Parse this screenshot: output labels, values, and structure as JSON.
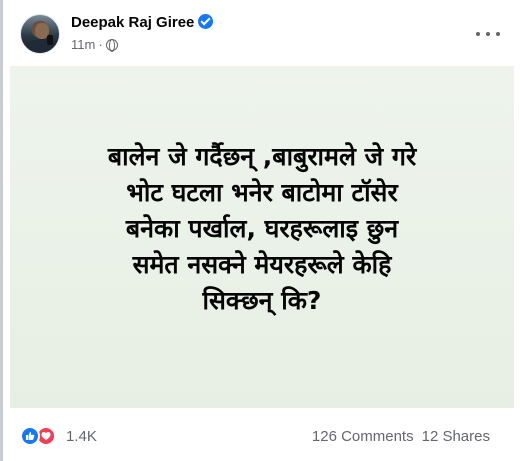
{
  "post": {
    "author": "Deepak Raj Giree",
    "verified": true,
    "time": "11m",
    "audience_icon": "globe-icon",
    "more_icon": "more-options-icon"
  },
  "card": {
    "background": "#e9f1e6",
    "lines": [
      "बालेन जे गर्दैछन् ,बाबुरामले जे गरे",
      "भोट घटला भनेर बाटोमा टॉसेर",
      "बनेका पर्खाल, घरहरूलाइ छुन",
      "समेत नसक्ने मेयरहरूले केहि",
      "सिक्छन् कि?"
    ]
  },
  "footer": {
    "reaction_icons": [
      "like-icon",
      "love-icon"
    ],
    "reaction_count": "1.4K",
    "comments": "126 Comments",
    "shares": "12 Shares"
  },
  "colors": {
    "brand_blue": "#1877f2",
    "love_red": "#f33e58",
    "secondary_text": "#65676b"
  }
}
